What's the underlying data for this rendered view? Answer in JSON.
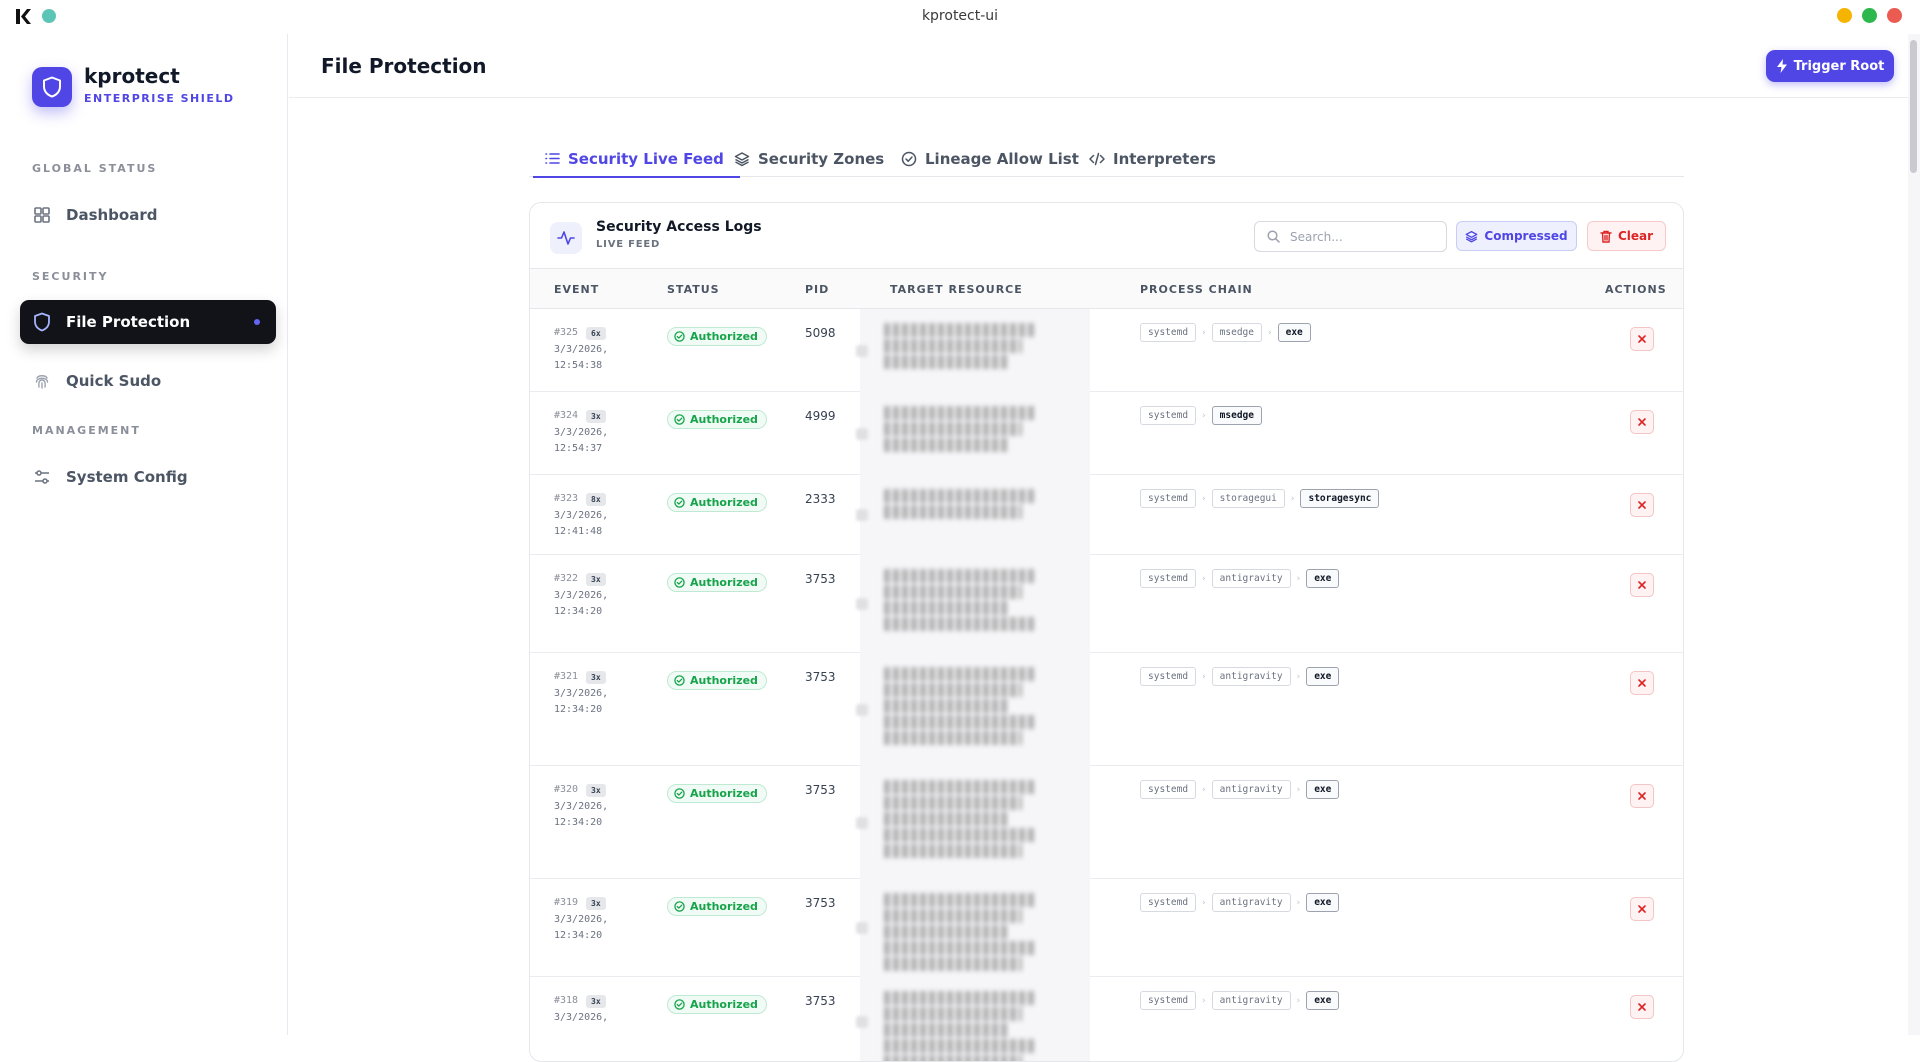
{
  "window": {
    "title": "kprotect-ui"
  },
  "brand": {
    "name": "kprotect",
    "subtitle": "ENTERPRISE SHIELD"
  },
  "sidebar": {
    "sections": [
      {
        "label": "GLOBAL STATUS",
        "items": [
          {
            "label": "Dashboard",
            "icon": "grid-icon",
            "active": false
          }
        ]
      },
      {
        "label": "SECURITY",
        "items": [
          {
            "label": "File Protection",
            "icon": "shield-icon",
            "active": true
          },
          {
            "label": "Quick Sudo",
            "icon": "fingerprint-icon",
            "active": false
          }
        ]
      },
      {
        "label": "MANAGEMENT",
        "items": [
          {
            "label": "System Config",
            "icon": "sliders-icon",
            "active": false
          }
        ]
      }
    ]
  },
  "header": {
    "title": "File Protection",
    "trigger_label": "Trigger Root"
  },
  "tabs": [
    {
      "label": "Security Live Feed",
      "icon": "list-icon",
      "active": true
    },
    {
      "label": "Security Zones",
      "icon": "layers-icon",
      "active": false
    },
    {
      "label": "Lineage Allow List",
      "icon": "check-circle-icon",
      "active": false
    },
    {
      "label": "Interpreters",
      "icon": "code-icon",
      "active": false
    }
  ],
  "logs": {
    "title": "Security Access Logs",
    "subtitle": "LIVE FEED",
    "search_placeholder": "Search...",
    "compressed_label": "Compressed",
    "clear_label": "Clear",
    "columns": [
      "EVENT",
      "STATUS",
      "PID",
      "TARGET RESOURCE",
      "PROCESS CHAIN",
      "ACTIONS"
    ],
    "rows": [
      {
        "id": "#325",
        "count": "6x",
        "date": "3/3/2026,",
        "time": "12:54:38",
        "status": "Authorized",
        "pid": "5098",
        "chain": [
          "systemd",
          "msedge",
          "exe"
        ]
      },
      {
        "id": "#324",
        "count": "3x",
        "date": "3/3/2026,",
        "time": "12:54:37",
        "status": "Authorized",
        "pid": "4999",
        "chain": [
          "systemd",
          "msedge"
        ]
      },
      {
        "id": "#323",
        "count": "8x",
        "date": "3/3/2026,",
        "time": "12:41:48",
        "status": "Authorized",
        "pid": "2333",
        "chain": [
          "systemd",
          "storagegui",
          "storagesync"
        ]
      },
      {
        "id": "#322",
        "count": "3x",
        "date": "3/3/2026,",
        "time": "12:34:20",
        "status": "Authorized",
        "pid": "3753",
        "chain": [
          "systemd",
          "antigravity",
          "exe"
        ]
      },
      {
        "id": "#321",
        "count": "3x",
        "date": "3/3/2026,",
        "time": "12:34:20",
        "status": "Authorized",
        "pid": "3753",
        "chain": [
          "systemd",
          "antigravity",
          "exe"
        ]
      },
      {
        "id": "#320",
        "count": "3x",
        "date": "3/3/2026,",
        "time": "12:34:20",
        "status": "Authorized",
        "pid": "3753",
        "chain": [
          "systemd",
          "antigravity",
          "exe"
        ]
      },
      {
        "id": "#319",
        "count": "3x",
        "date": "3/3/2026,",
        "time": "12:34:20",
        "status": "Authorized",
        "pid": "3753",
        "chain": [
          "systemd",
          "antigravity",
          "exe"
        ]
      },
      {
        "id": "#318",
        "count": "3x",
        "date": "3/3/2026,",
        "time": "",
        "status": "Authorized",
        "pid": "3753",
        "chain": [
          "systemd",
          "antigravity",
          "exe"
        ]
      }
    ]
  },
  "colors": {
    "accent": "#4f46e5",
    "success": "#16a34a",
    "danger": "#dc2626"
  }
}
